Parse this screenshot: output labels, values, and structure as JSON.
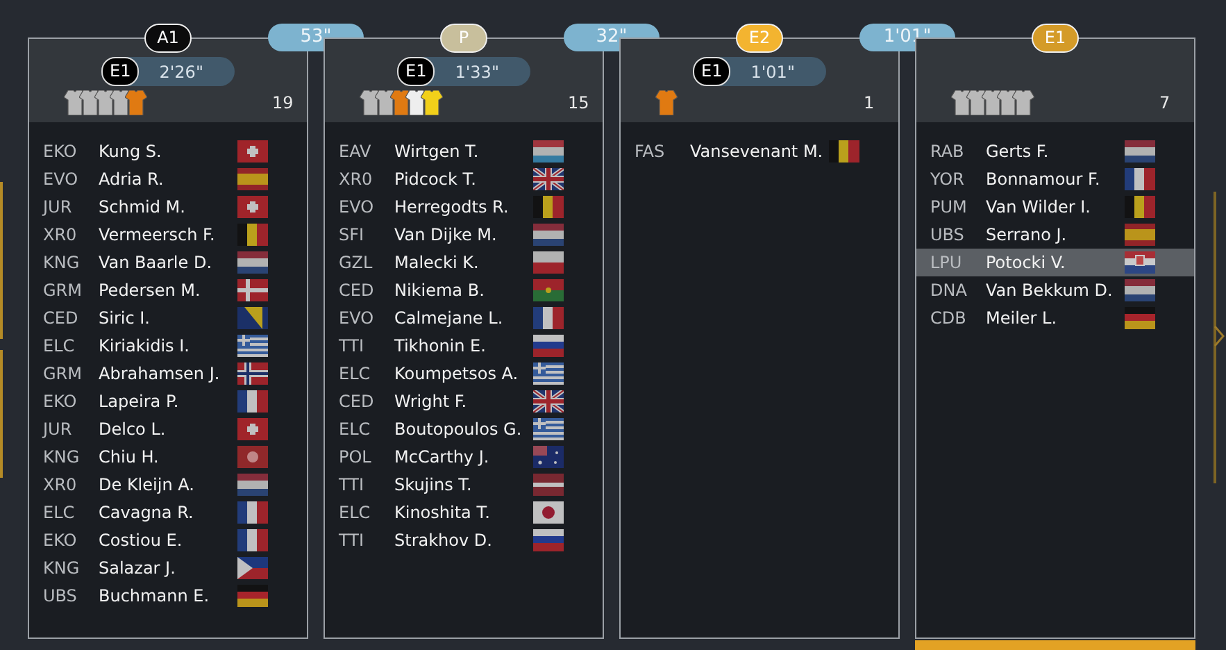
{
  "groups": [
    {
      "badge": {
        "label": "A1",
        "color": "#0b0b0c"
      },
      "leader": {
        "label": "E1",
        "time": "2'26\""
      },
      "jerseys": [
        {
          "color": "#b9b9b9"
        },
        {
          "color": "#b9b9b9"
        },
        {
          "color": "#b9b9b9"
        },
        {
          "color": "#b9b9b9"
        },
        {
          "color": "#e07a12"
        }
      ],
      "count": "19",
      "riders": [
        {
          "team": "EKO",
          "name": "Kung S.",
          "flag": {
            "kind": "ch"
          },
          "selected": false
        },
        {
          "team": "EVO",
          "name": "Adria R.",
          "flag": {
            "kind": "es"
          },
          "selected": false
        },
        {
          "team": "JUR",
          "name": "Schmid M.",
          "flag": {
            "kind": "ch"
          },
          "selected": false
        },
        {
          "team": "XR0",
          "name": "Vermeersch F.",
          "flag": {
            "kind": "be"
          },
          "selected": false
        },
        {
          "team": "KNG",
          "name": "Van Baarle D.",
          "flag": {
            "kind": "nl"
          },
          "selected": false
        },
        {
          "team": "GRM",
          "name": "Pedersen M.",
          "flag": {
            "kind": "dk"
          },
          "selected": false
        },
        {
          "team": "CED",
          "name": "Siric I.",
          "flag": {
            "kind": "ba"
          },
          "selected": false
        },
        {
          "team": "ELC",
          "name": "Kiriakidis I.",
          "flag": {
            "kind": "gr"
          },
          "selected": false
        },
        {
          "team": "GRM",
          "name": "Abrahamsen J.",
          "flag": {
            "kind": "no"
          },
          "selected": false
        },
        {
          "team": "EKO",
          "name": "Lapeira P.",
          "flag": {
            "kind": "fr"
          },
          "selected": false
        },
        {
          "team": "JUR",
          "name": "Delco L.",
          "flag": {
            "kind": "ch"
          },
          "selected": false
        },
        {
          "team": "KNG",
          "name": "Chiu H.",
          "flag": {
            "kind": "hk"
          },
          "selected": false
        },
        {
          "team": "XR0",
          "name": "De Kleijn A.",
          "flag": {
            "kind": "nl"
          },
          "selected": false
        },
        {
          "team": "ELC",
          "name": "Cavagna R.",
          "flag": {
            "kind": "fr"
          },
          "selected": false
        },
        {
          "team": "EKO",
          "name": "Costiou E.",
          "flag": {
            "kind": "fr"
          },
          "selected": false
        },
        {
          "team": "KNG",
          "name": "Salazar J.",
          "flag": {
            "kind": "ph"
          },
          "selected": false
        },
        {
          "team": "UBS",
          "name": "Buchmann E.",
          "flag": {
            "kind": "de"
          },
          "selected": false
        }
      ]
    },
    {
      "badge": {
        "label": "P",
        "color": "#c8bf9c"
      },
      "leader": {
        "label": "E1",
        "time": "1'33\""
      },
      "jerseys": [
        {
          "color": "#b9b9b9"
        },
        {
          "color": "#b9b9b9"
        },
        {
          "color": "#e07a12"
        },
        {
          "color": "#eeeeee"
        },
        {
          "color": "#f2d01a"
        }
      ],
      "count": "15",
      "riders": [
        {
          "team": "EAV",
          "name": "Wirtgen T.",
          "flag": {
            "kind": "lu"
          },
          "selected": false
        },
        {
          "team": "XR0",
          "name": "Pidcock T.",
          "flag": {
            "kind": "gb"
          },
          "selected": false
        },
        {
          "team": "EVO",
          "name": "Herregodts R.",
          "flag": {
            "kind": "be"
          },
          "selected": false
        },
        {
          "team": "SFI",
          "name": "Van Dijke M.",
          "flag": {
            "kind": "nl"
          },
          "selected": false
        },
        {
          "team": "GZL",
          "name": "Malecki K.",
          "flag": {
            "kind": "pl"
          },
          "selected": false
        },
        {
          "team": "CED",
          "name": "Nikiema B.",
          "flag": {
            "kind": "bf"
          },
          "selected": false
        },
        {
          "team": "EVO",
          "name": "Calmejane L.",
          "flag": {
            "kind": "fr"
          },
          "selected": false
        },
        {
          "team": "TTI",
          "name": "Tikhonin E.",
          "flag": {
            "kind": "ru"
          },
          "selected": false
        },
        {
          "team": "ELC",
          "name": "Koumpetsos A.",
          "flag": {
            "kind": "gr"
          },
          "selected": false
        },
        {
          "team": "CED",
          "name": "Wright F.",
          "flag": {
            "kind": "gb"
          },
          "selected": false
        },
        {
          "team": "ELC",
          "name": "Boutopoulos G.",
          "flag": {
            "kind": "gr"
          },
          "selected": false
        },
        {
          "team": "POL",
          "name": "McCarthy J.",
          "flag": {
            "kind": "au"
          },
          "selected": false
        },
        {
          "team": "TTI",
          "name": "Skujins T.",
          "flag": {
            "kind": "lv"
          },
          "selected": false
        },
        {
          "team": "ELC",
          "name": "Kinoshita T.",
          "flag": {
            "kind": "jp"
          },
          "selected": false
        },
        {
          "team": "TTI",
          "name": "Strakhov D.",
          "flag": {
            "kind": "ru"
          },
          "selected": false
        }
      ]
    },
    {
      "badge": {
        "label": "E2",
        "color": "#f3b430"
      },
      "leader": {
        "label": "E1",
        "time": "1'01\""
      },
      "jerseys": [
        {
          "color": "#e07a12"
        }
      ],
      "count": "1",
      "riders": [
        {
          "team": "FAS",
          "name": "Vansevenant M.",
          "flag": {
            "kind": "be"
          },
          "selected": false
        }
      ]
    },
    {
      "badge": {
        "label": "E1",
        "color": "#d49b28"
      },
      "jerseys": [
        {
          "color": "#b9b9b9"
        },
        {
          "color": "#b9b9b9"
        },
        {
          "color": "#b9b9b9"
        },
        {
          "color": "#b9b9b9"
        },
        {
          "color": "#b9b9b9"
        }
      ],
      "count": "7",
      "riders": [
        {
          "team": "RAB",
          "name": "Gerts F.",
          "flag": {
            "kind": "nl"
          },
          "selected": false
        },
        {
          "team": "YOR",
          "name": "Bonnamour F.",
          "flag": {
            "kind": "fr"
          },
          "selected": false
        },
        {
          "team": "PUM",
          "name": "Van Wilder I.",
          "flag": {
            "kind": "be"
          },
          "selected": false
        },
        {
          "team": "UBS",
          "name": "Serrano J.",
          "flag": {
            "kind": "es"
          },
          "selected": false
        },
        {
          "team": "LPU",
          "name": "Potocki V.",
          "flag": {
            "kind": "hr"
          },
          "selected": true
        },
        {
          "team": "DNA",
          "name": "Van Bekkum D.",
          "flag": {
            "kind": "nl"
          },
          "selected": false
        },
        {
          "team": "CDB",
          "name": "Meiler L.",
          "flag": {
            "kind": "de"
          },
          "selected": false
        }
      ]
    }
  ],
  "gaps": [
    "53\"",
    "32\"",
    "1'01\""
  ]
}
